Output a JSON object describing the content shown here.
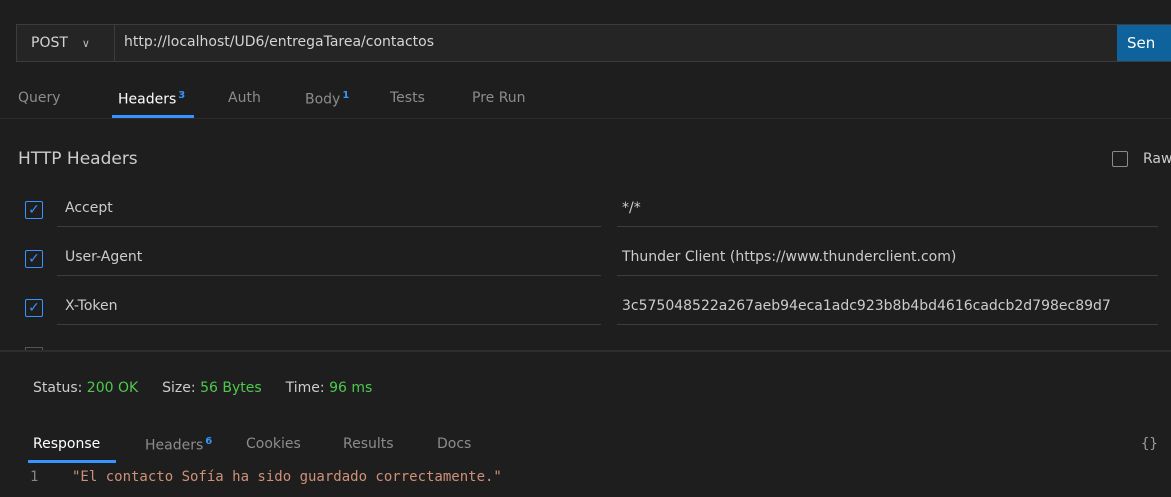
{
  "request": {
    "method": "POST",
    "url": "http://localhost/UD6/entregaTarea/contactos",
    "send_label": "Sen"
  },
  "request_tabs": [
    {
      "label": "Query",
      "badge": ""
    },
    {
      "label": "Headers",
      "badge": "3"
    },
    {
      "label": "Auth",
      "badge": ""
    },
    {
      "label": "Body",
      "badge": "1"
    },
    {
      "label": "Tests",
      "badge": ""
    },
    {
      "label": "Pre Run",
      "badge": ""
    }
  ],
  "headers_section": {
    "title": "HTTP Headers",
    "raw_label": "Raw",
    "rows": [
      {
        "key": "Accept",
        "value": "*/*",
        "checked": true
      },
      {
        "key": "User-Agent",
        "value": "Thunder Client (https://www.thunderclient.com)",
        "checked": true
      },
      {
        "key": "X-Token",
        "value": "3c575048522a267aeb94eca1adc923b8b4bd4616cadcb2d798ec89d7",
        "checked": true
      }
    ]
  },
  "status_bar": {
    "status_label": "Status:",
    "status_value": "200 OK",
    "size_label": "Size:",
    "size_value": "56 Bytes",
    "time_label": "Time:",
    "time_value": "96 ms"
  },
  "response_tabs": [
    {
      "label": "Response",
      "badge": ""
    },
    {
      "label": "Headers",
      "badge": "6"
    },
    {
      "label": "Cookies",
      "badge": ""
    },
    {
      "label": "Results",
      "badge": ""
    },
    {
      "label": "Docs",
      "badge": ""
    }
  ],
  "response_body": {
    "line_number": "1",
    "content": "\"El contacto Sofía ha sido guardado correctamente.\""
  },
  "colors": {
    "accent": "#3794ff",
    "send_button": "#0e639c",
    "status_ok": "#4ec94e",
    "string_literal": "#ce9178",
    "background": "#1e1e1e"
  },
  "icons": {
    "method_dropdown": "chevron-down-icon",
    "checkbox": "checkmark-icon",
    "format_toggle": "braces-icon"
  }
}
